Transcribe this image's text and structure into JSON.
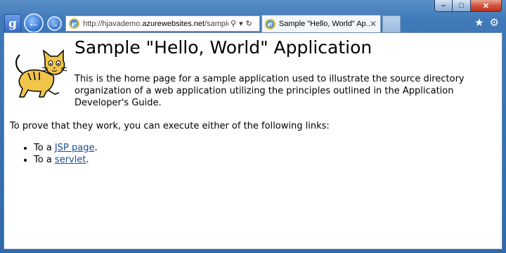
{
  "browser": {
    "address_bar": {
      "url_prefix": "http://hjavademo.",
      "url_domain": "azurewebsites.net",
      "url_suffix": "/sample/"
    },
    "tab": {
      "title": "Sample \"Hello, World\" Ap...",
      "close_glyph": "✕"
    },
    "icons": [
      "search-icon",
      "refresh-icon",
      "favorites-star-icon",
      "tools-gear-icon"
    ],
    "window_buttons": {
      "minimize": "–",
      "maximize": "□",
      "close": "✕"
    }
  },
  "page": {
    "title": "Sample \"Hello, World\" Application",
    "intro": "This is the home page for a sample application used to illustrate the source directory organization of a web application utilizing the principles outlined in the Application Developer's Guide.",
    "prove_text": "To prove that they work, you can execute either of the following links:",
    "links": [
      {
        "prefix": "To a ",
        "link_text": "JSP page",
        "suffix": "."
      },
      {
        "prefix": "To a ",
        "link_text": "servlet",
        "suffix": "."
      }
    ]
  },
  "colors": {
    "frame": "#3f79b8",
    "link": "#1a4d8f",
    "close_button": "#d3533c"
  }
}
